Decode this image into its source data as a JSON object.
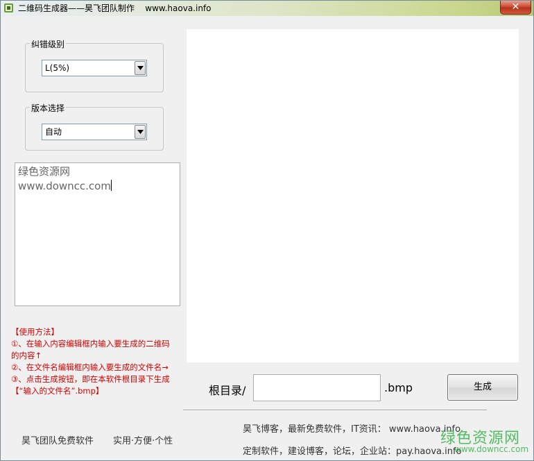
{
  "window": {
    "title": "二维码生成器——昊飞团队制作    www.haova.info",
    "close_label": "✕"
  },
  "error_level": {
    "legend": "纠错级别",
    "selected": "L(5%)"
  },
  "version": {
    "legend": "版本选择",
    "selected": "自动"
  },
  "content": {
    "line1": "绿色资源网",
    "line2": "www.downcc.com"
  },
  "instructions": {
    "heading": "【使用方法】",
    "line1": "①、在输入内容编辑框内输入要生成的二维码",
    "line2": "的内容↑",
    "line3": "②、在文件名编辑框内输入要生成的文件名→",
    "line4": "③、点击生成按钮，即在本软件根目录下生成",
    "line5": "【“输入的文件名”.bmp】"
  },
  "output": {
    "root_label": "根目录/",
    "filename_value": "",
    "extension": ".bmp",
    "generate_label": "生成"
  },
  "footer": {
    "team": "昊飞团队免费软件",
    "slogan": "实用·方便·个性",
    "blog_line": "昊飞博客，最新免费软件，IT资讯： www.haova.info",
    "custom_line": "定制软件，建设博客，论坛，企业站：pay.haova.info"
  },
  "watermark": {
    "name": "绿色资源网",
    "url": "www.downcc.com"
  },
  "colors": {
    "instruction_text": "#d40000",
    "watermark": "#37b34a",
    "close_button": "#c8452d"
  }
}
